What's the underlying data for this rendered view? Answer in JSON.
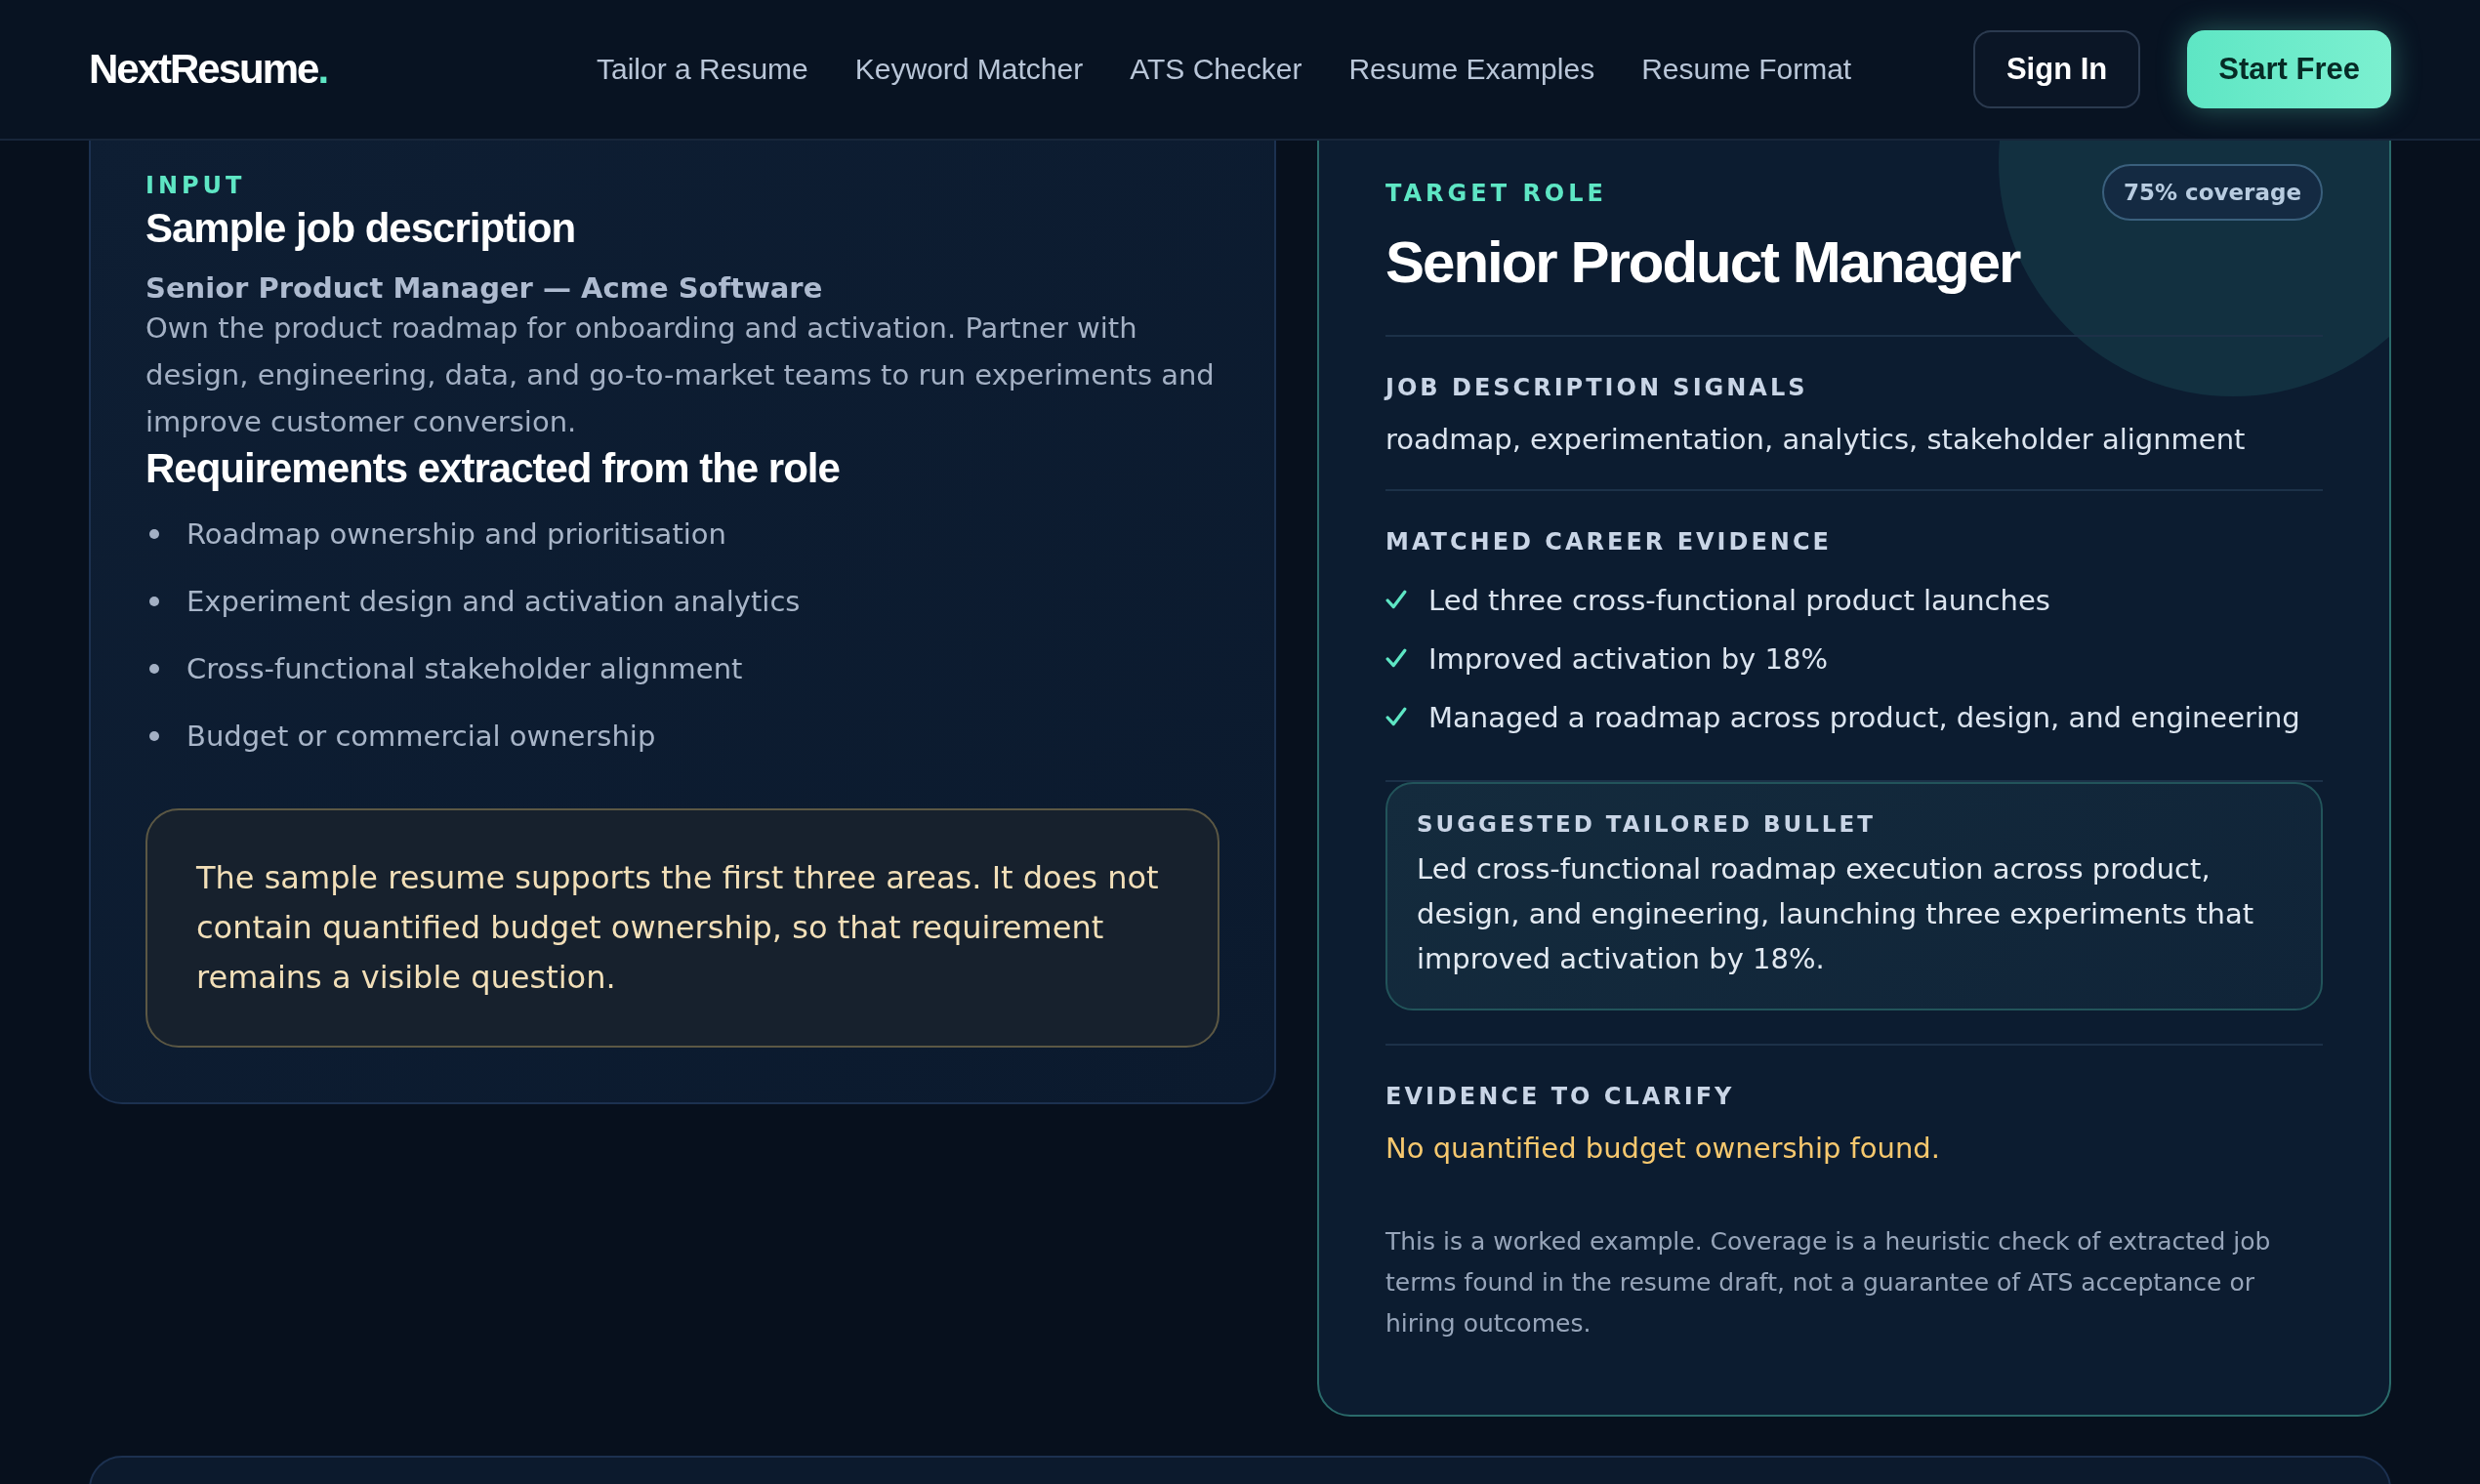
{
  "header": {
    "logo": {
      "name": "NextResume",
      "mark": "."
    },
    "nav": [
      {
        "label": "Tailor a Resume"
      },
      {
        "label": "Keyword Matcher"
      },
      {
        "label": "ATS Checker"
      },
      {
        "label": "Resume Examples"
      },
      {
        "label": "Resume Format"
      }
    ],
    "sign_in": "Sign In",
    "start_free": "Start Free"
  },
  "input_card": {
    "eyebrow": "INPUT",
    "title": "Sample job description",
    "job_title": "Senior Product Manager — Acme Software",
    "description": "Own the product roadmap for onboarding and activation. Partner with design, engineering, data, and go-to-market teams to run experiments and improve customer conversion.",
    "requirements_title": "Requirements extracted from the role",
    "requirements": [
      "Roadmap ownership and prioritisation",
      "Experiment design and activation analytics",
      "Cross-functional stakeholder alignment",
      "Budget or commercial ownership"
    ],
    "note": "The sample resume supports the first three areas. It does not contain quantified budget ownership, so that requirement remains a visible question."
  },
  "target_card": {
    "eyebrow": "TARGET ROLE",
    "badge": "75% coverage",
    "title": "Senior Product Manager",
    "sections": [
      {
        "kind": "text",
        "heading": "JOB DESCRIPTION SIGNALS",
        "text": "roadmap, experimentation, analytics, stakeholder alignment"
      },
      {
        "kind": "checklist",
        "heading": "MATCHED CAREER EVIDENCE",
        "items": [
          "Led three cross-functional product launches",
          "Improved activation by 18%",
          "Managed a roadmap across product, design, and engineering"
        ]
      },
      {
        "kind": "callout",
        "heading": "SUGGESTED TAILORED BULLET",
        "text": "Led cross-functional roadmap execution across product, design, and engineering, launching three experiments that improved activation by 18%."
      },
      {
        "kind": "warning",
        "heading": "EVIDENCE TO CLARIFY",
        "text": "No quantified budget ownership found."
      }
    ],
    "disclaimer": "This is a worked example. Coverage is a heuristic check of extracted job terms found in the resume draft, not a guarantee of ATS acceptance or hiring outcomes."
  }
}
